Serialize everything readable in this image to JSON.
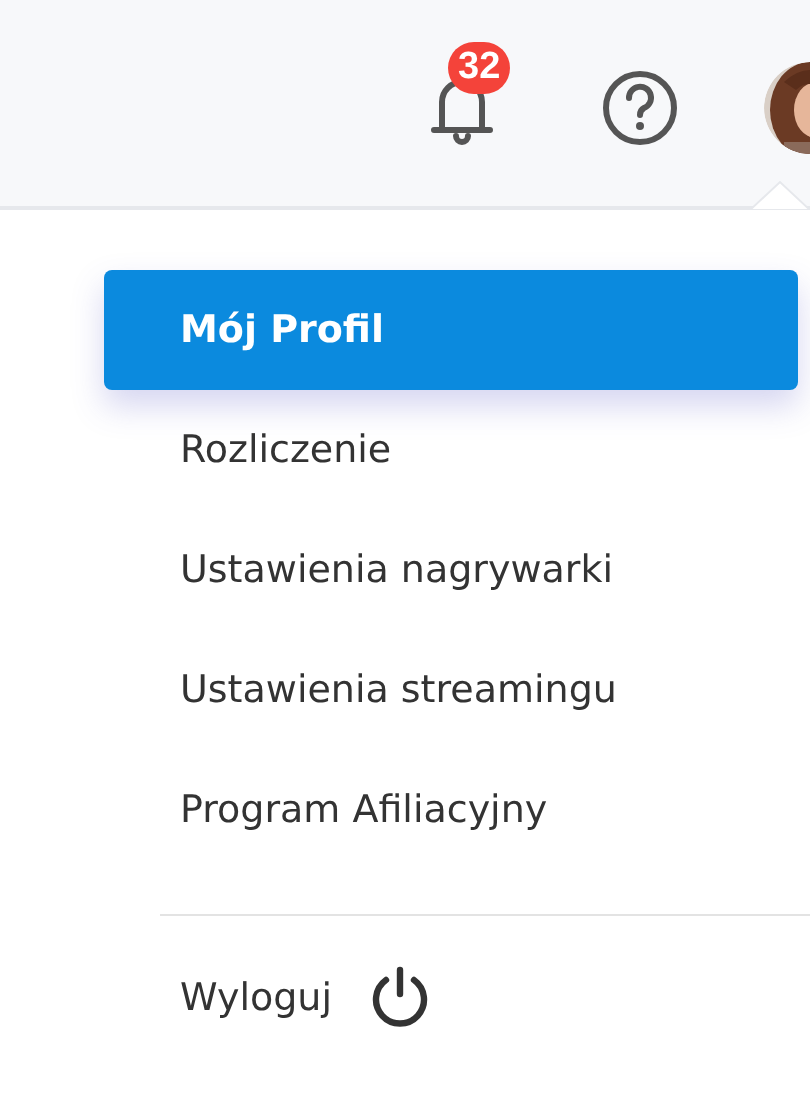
{
  "header": {
    "notification_count": "32"
  },
  "menu": {
    "items": [
      {
        "label": "Mój Profil",
        "selected": true
      },
      {
        "label": "Rozliczenie",
        "selected": false
      },
      {
        "label": "Ustawienia nagrywarki",
        "selected": false
      },
      {
        "label": "Ustawienia streamingu",
        "selected": false
      },
      {
        "label": "Program Afiliacyjny",
        "selected": false
      }
    ],
    "logout": {
      "label": "Wyloguj"
    }
  }
}
